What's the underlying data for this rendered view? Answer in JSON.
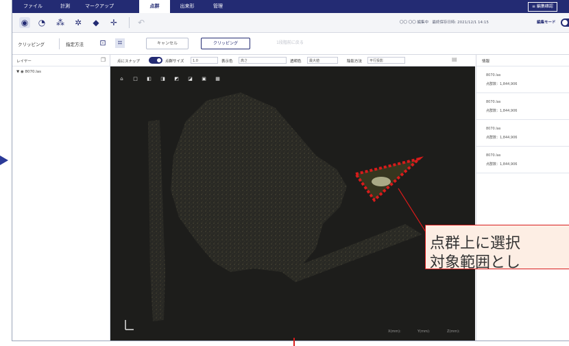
{
  "menu": {
    "items": [
      "ファイル",
      "計測",
      "マークアップ",
      "点群",
      "出来形",
      "管理"
    ],
    "active_index": 3,
    "right_button": "≡ 編集確認"
  },
  "toolbar": {
    "info_text": "〇〇 〇〇 編集中　最終保存日時: 2021/12/1 14:15",
    "edit_mode_label": "編集モード"
  },
  "clipping": {
    "title": "クリッピング",
    "method_label": "指定方法",
    "cancel_label": "キャンセル",
    "clip_label": "クリッピング",
    "undo_label": "1段階前に戻る"
  },
  "layers": {
    "title": "レイヤー",
    "item": "▼ ◉ 8070.las"
  },
  "viewer_bar": {
    "snap_label": "点にスナップ",
    "point_size_label": "点群サイズ",
    "point_size_value": "1.0",
    "display_label": "表示色",
    "display_value": "高さ",
    "layer_label": "透明色",
    "layer_value": "最大値",
    "shade_label": "陰影方法",
    "shade_value": "平行投影"
  },
  "viewer": {
    "coord_x": "X(mm):",
    "coord_y": "Y(mm):",
    "coord_z": "Z(mm):",
    "axis_label": "L"
  },
  "info_panel": {
    "title": "情報",
    "cards": [
      {
        "name": "8070.las",
        "count": "点群数：1,844,906"
      },
      {
        "name": "8070.las",
        "count": "点群数：1,844,906"
      },
      {
        "name": "8070.las",
        "count": "点群数：1,844,906"
      },
      {
        "name": "8070.las",
        "count": "点群数：1,844,906"
      }
    ]
  },
  "callout": {
    "line1": "点群上に選択",
    "line2": "対象範囲とし"
  },
  "colors": {
    "brand": "#232b73",
    "annotation_red": "#d81b1b",
    "callout_bg": "#fdeee4"
  }
}
